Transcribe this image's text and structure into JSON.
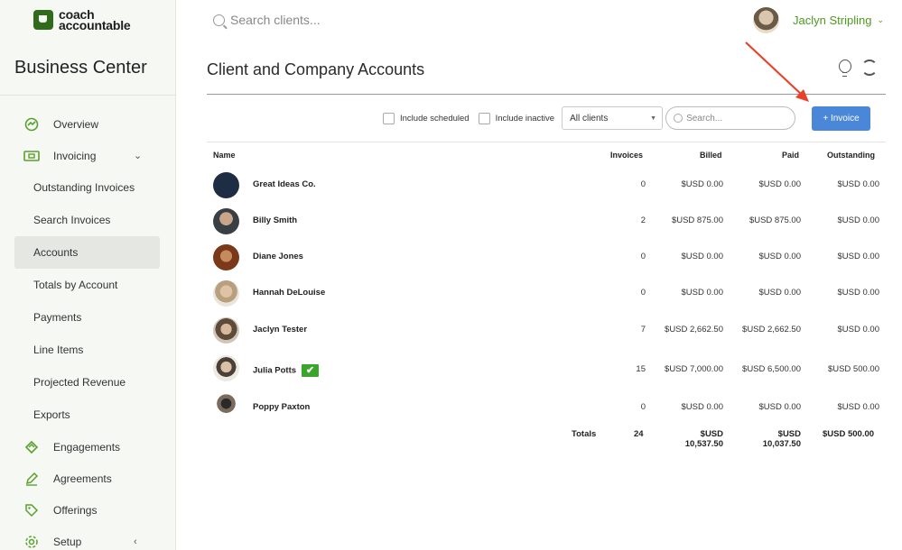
{
  "app": {
    "logo_line1": "coach",
    "logo_line2": "accountable",
    "section_title": "Business Center",
    "brand_color": "#4e9a1f"
  },
  "sidebar": {
    "items": [
      {
        "label": "Overview",
        "icon": "overview-icon",
        "type": "main"
      },
      {
        "label": "Invoicing",
        "icon": "invoice-icon",
        "type": "main",
        "chevron": "down"
      },
      {
        "label": "Outstanding Invoices",
        "type": "sub"
      },
      {
        "label": "Search Invoices",
        "type": "sub"
      },
      {
        "label": "Accounts",
        "type": "sub",
        "active": true
      },
      {
        "label": "Totals by Account",
        "type": "sub"
      },
      {
        "label": "Payments",
        "type": "sub"
      },
      {
        "label": "Line Items",
        "type": "sub"
      },
      {
        "label": "Projected Revenue",
        "type": "sub"
      },
      {
        "label": "Exports",
        "type": "sub"
      },
      {
        "label": "Engagements",
        "icon": "engagements-icon",
        "type": "main"
      },
      {
        "label": "Agreements",
        "icon": "pen-icon",
        "type": "main"
      },
      {
        "label": "Offerings",
        "icon": "tag-icon",
        "type": "main"
      },
      {
        "label": "Setup",
        "icon": "gear-icon",
        "type": "main",
        "chevron": "left"
      }
    ]
  },
  "topbar": {
    "search_placeholder": "Search clients...",
    "user_name": "Jaclyn Stripling"
  },
  "page": {
    "title": "Client and Company Accounts"
  },
  "filters": {
    "include_scheduled": "Include scheduled",
    "include_inactive": "Include inactive",
    "client_select": "All clients",
    "search_placeholder": "Search...",
    "invoice_button": "+ Invoice"
  },
  "table": {
    "headers": {
      "name": "Name",
      "invoices": "Invoices",
      "billed": "Billed",
      "paid": "Paid",
      "outstanding": "Outstanding"
    },
    "rows": [
      {
        "name": "Great Ideas Co.",
        "invoices": "0",
        "billed": "$USD 0.00",
        "paid": "$USD 0.00",
        "outstanding": "$USD 0.00"
      },
      {
        "name": "Billy Smith",
        "invoices": "2",
        "billed": "$USD 875.00",
        "paid": "$USD 875.00",
        "outstanding": "$USD 0.00"
      },
      {
        "name": "Diane Jones",
        "invoices": "0",
        "billed": "$USD 0.00",
        "paid": "$USD 0.00",
        "outstanding": "$USD 0.00"
      },
      {
        "name": "Hannah DeLouise",
        "invoices": "0",
        "billed": "$USD 0.00",
        "paid": "$USD 0.00",
        "outstanding": "$USD 0.00"
      },
      {
        "name": "Jaclyn Tester",
        "invoices": "7",
        "billed": "$USD 2,662.50",
        "paid": "$USD 2,662.50",
        "outstanding": "$USD 0.00"
      },
      {
        "name": "Julia Potts",
        "invoices": "15",
        "billed": "$USD 7,000.00",
        "paid": "$USD 6,500.00",
        "outstanding": "$USD 500.00",
        "checked": true
      },
      {
        "name": "Poppy Paxton",
        "invoices": "0",
        "billed": "$USD 0.00",
        "paid": "$USD 0.00",
        "outstanding": "$USD 0.00"
      }
    ],
    "totals": {
      "label": "Totals",
      "invoices": "24",
      "billed_line1": "$USD",
      "billed_line2": "10,537.50",
      "paid_line1": "$USD",
      "paid_line2": "10,037.50",
      "outstanding": "$USD 500.00"
    }
  },
  "annotation": {
    "arrow_color": "#e8432a"
  }
}
